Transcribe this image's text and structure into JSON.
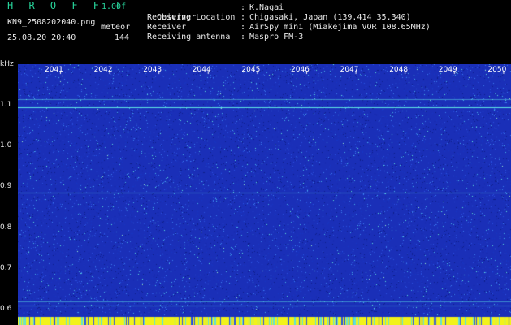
{
  "header": {
    "brand": "H R O F F T",
    "version": "1.00f",
    "filename": "KN9_2508202040.png",
    "mode": "meteor",
    "datetime": "25.08.20 20:40",
    "count": "144",
    "fields": [
      {
        "label": "Observer",
        "sep": ":",
        "value": "K.Nagai"
      },
      {
        "label": "Receiving Location",
        "sep": ":",
        "value": "Chigasaki, Japan (139.414 35.340)"
      },
      {
        "label": "Receiver",
        "sep": ":",
        "value": "AirSpy mini (Miakejima VOR 108.65MHz)"
      },
      {
        "label": "Receiving antenna",
        "sep": ":",
        "value": "Maspro FM-3"
      }
    ]
  },
  "axis": {
    "unit": "kHz",
    "y_labels": [
      "1.1",
      "1.0",
      "0.9",
      "0.8",
      "0.7",
      "0.6"
    ],
    "time_labels": [
      "2041",
      "2042",
      "2043",
      "2044",
      "2045",
      "2046",
      "2047",
      "2048",
      "2049",
      "2050"
    ]
  },
  "colors": {
    "background": "#1a2fb8",
    "carrier": "#5ee6e6",
    "noise_hi": "#5fe0d8",
    "strip": "#f2f21a"
  }
}
